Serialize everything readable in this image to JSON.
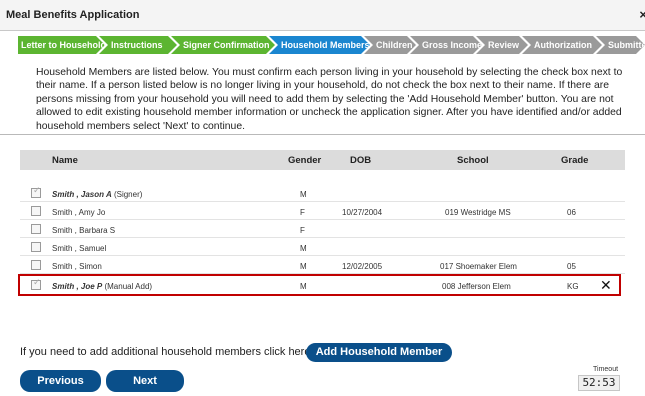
{
  "window": {
    "title": "Meal Benefits Application",
    "close_glyph": "×"
  },
  "steps": [
    {
      "label": "Letter to Household",
      "state": "done"
    },
    {
      "label": "Instructions",
      "state": "done"
    },
    {
      "label": "Signer Confirmation",
      "state": "done"
    },
    {
      "label": "Household Members",
      "state": "active"
    },
    {
      "label": "Children",
      "state": "todo"
    },
    {
      "label": "Gross Income",
      "state": "todo"
    },
    {
      "label": "Review",
      "state": "todo"
    },
    {
      "label": "Authorization",
      "state": "todo"
    },
    {
      "label": "Submitted",
      "state": "todo"
    }
  ],
  "intro_text": "Household Members are listed below. You must confirm each person living in your household by selecting the check box next to their name. If a person listed below is no longer living in your household, do not check the box next to their name. If there are persons missing from your household you will need to add them by selecting the 'Add Household Member' button. You are not allowed to edit existing household member information or uncheck the application signer. After you have identified and/or added household members select 'Next' to continue.",
  "table": {
    "headers": {
      "name": "Name",
      "gender": "Gender",
      "dob": "DOB",
      "school": "School",
      "grade": "Grade"
    },
    "rows": [
      {
        "name": "Smith , Jason A",
        "note": "(Signer)",
        "bold": true,
        "checked": true,
        "gender": "M",
        "dob": "",
        "school": "",
        "grade": ""
      },
      {
        "name": "Smith , Amy Jo",
        "note": "",
        "bold": false,
        "checked": false,
        "gender": "F",
        "dob": "10/27/2004",
        "school": "019 Westridge MS",
        "grade": "06"
      },
      {
        "name": "Smith , Barbara S",
        "note": "",
        "bold": false,
        "checked": false,
        "gender": "F",
        "dob": "",
        "school": "",
        "grade": ""
      },
      {
        "name": "Smith , Samuel",
        "note": "",
        "bold": false,
        "checked": false,
        "gender": "M",
        "dob": "",
        "school": "",
        "grade": ""
      },
      {
        "name": "Smith , Simon",
        "note": "",
        "bold": false,
        "checked": false,
        "gender": "M",
        "dob": "12/02/2005",
        "school": "017 Shoemaker Elem",
        "grade": "05"
      },
      {
        "name": "Smith , Joe P",
        "note": "(Manual Add)",
        "bold": true,
        "checked": true,
        "gender": "M",
        "dob": "",
        "school": "008 Jefferson Elem",
        "grade": "KG",
        "removable": true,
        "highlighted": true
      }
    ]
  },
  "remove_glyph": "✕",
  "add_prompt": "If you need to add additional household members click here.",
  "buttons": {
    "add": "Add Household Member",
    "previous": "Previous",
    "next": "Next"
  },
  "timeout": {
    "label": "Timeout",
    "value": "52:53"
  },
  "colors": {
    "step_done": "#5cb531",
    "step_active": "#1a86d0",
    "step_todo": "#9a9a9a",
    "button": "#0a4f8a",
    "highlight_border": "#c00000"
  }
}
